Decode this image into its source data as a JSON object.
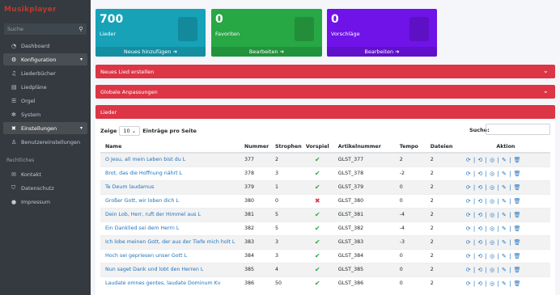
{
  "brand": "Musikplayer",
  "search": {
    "placeholder": "Suche"
  },
  "nav": {
    "dashboard": "Dashboard",
    "konfiguration": "Konfiguration",
    "liederbuecher": "Liederbücher",
    "liedplaene": "Liedpläne",
    "orgel": "Orgel",
    "system": "System",
    "einstellungen": "Einstellungen",
    "benutzereinstellungen": "Benutzereinstellungen",
    "rechtliches": "Rechtliches",
    "kontakt": "Kontakt",
    "datenschutz": "Datenschutz",
    "impressum": "Impressum"
  },
  "cards": [
    {
      "value": "700",
      "label": "Lieder",
      "action": "Neues hinzufügen"
    },
    {
      "value": "0",
      "label": "Favoriten",
      "action": "Bearbeiten"
    },
    {
      "value": "0",
      "label": "Vorschläge",
      "action": "Bearbeiten"
    }
  ],
  "sections": {
    "neues_lied": "Neues Lied erstellen",
    "globale": "Globale Anpassungen",
    "lieder": "Lieder"
  },
  "table_controls": {
    "zeige": "Zeige",
    "entries": "10",
    "eintraege": "Einträge pro Seite",
    "suche": "Suche:"
  },
  "columns": [
    "Name",
    "Nummer",
    "Strophen",
    "Vorspiel",
    "Artikelnummer",
    "Tempo",
    "Dateien",
    "Aktion"
  ],
  "rows": [
    {
      "name": "O Jesu, all mein Leben bist du L",
      "nummer": "377",
      "strophen": "2",
      "vorspiel": "✔",
      "artikel": "GLST_377",
      "tempo": "2",
      "dateien": "2"
    },
    {
      "name": "Brot, das die Hoffnung nährt L",
      "nummer": "378",
      "strophen": "3",
      "vorspiel": "✔",
      "artikel": "GLST_378",
      "tempo": "-2",
      "dateien": "2"
    },
    {
      "name": "Te Deum laudamus",
      "nummer": "379",
      "strophen": "1",
      "vorspiel": "✔",
      "artikel": "GLST_379",
      "tempo": "0",
      "dateien": "2"
    },
    {
      "name": "Großer Gott, wir loben dich L",
      "nummer": "380",
      "strophen": "0",
      "vorspiel": "✖",
      "artikel": "GLST_380",
      "tempo": "0",
      "dateien": "2"
    },
    {
      "name": "Dein Lob, Herr, ruft der Himmel aus L",
      "nummer": "381",
      "strophen": "5",
      "vorspiel": "✔",
      "artikel": "GLST_381",
      "tempo": "-4",
      "dateien": "2"
    },
    {
      "name": "Ein Danklied sei dem Herrn L",
      "nummer": "382",
      "strophen": "5",
      "vorspiel": "✔",
      "artikel": "GLST_382",
      "tempo": "-4",
      "dateien": "2"
    },
    {
      "name": "Ich lobe meinen Gott, der aus der Tiefe mich holt L",
      "nummer": "383",
      "strophen": "3",
      "vorspiel": "✔",
      "artikel": "GLST_383",
      "tempo": "-3",
      "dateien": "2"
    },
    {
      "name": "Hoch sei gepriesen unser Gott L",
      "nummer": "384",
      "strophen": "3",
      "vorspiel": "✔",
      "artikel": "GLST_384",
      "tempo": "0",
      "dateien": "2"
    },
    {
      "name": "Nun saget Dank und lobt den Herren L",
      "nummer": "385",
      "strophen": "4",
      "vorspiel": "✔",
      "artikel": "GLST_385",
      "tempo": "0",
      "dateien": "2"
    },
    {
      "name": "Laudate omnes gentes, laudate Dominum Kv",
      "nummer": "386",
      "strophen": "50",
      "vorspiel": "✔",
      "artikel": "GLST_386",
      "tempo": "0",
      "dateien": "2"
    }
  ],
  "row_actions": "⟳ | ⟲ | ◎ | ✎ | 🗑"
}
